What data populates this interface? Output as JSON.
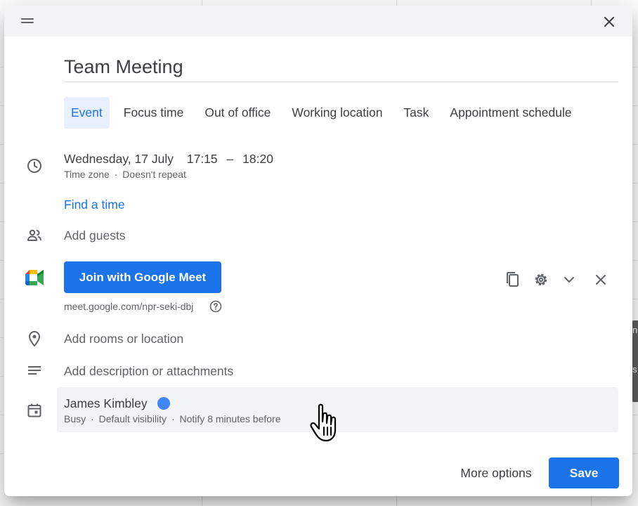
{
  "event": {
    "title": "Team Meeting",
    "date": "Wednesday, 17 July",
    "start_time": "17:15",
    "time_separator": "–",
    "end_time": "18:20",
    "time_zone": "Time zone",
    "repeat": "Doesn't repeat",
    "dot_separator": "·"
  },
  "tabs": [
    {
      "label": "Event",
      "active": true
    },
    {
      "label": "Focus time",
      "active": false
    },
    {
      "label": "Out of office",
      "active": false
    },
    {
      "label": "Working location",
      "active": false
    },
    {
      "label": "Task",
      "active": false
    },
    {
      "label": "Appointment schedule",
      "active": false
    }
  ],
  "find_time_label": "Find a time",
  "guests_placeholder": "Add guests",
  "meet": {
    "join_label": "Join with Google Meet",
    "link": "meet.google.com/npr-seki-dbj"
  },
  "location_placeholder": "Add rooms or location",
  "description_placeholder": "Add description or attachments",
  "calendar": {
    "owner": "James Kimbley",
    "color": "#4285f4",
    "status": "Busy",
    "visibility": "Default visibility",
    "notification": "Notify 8 minutes before"
  },
  "footer": {
    "more_options_label": "More options",
    "save_label": "Save"
  },
  "background_event_fragments": [
    "n",
    "s"
  ],
  "colors": {
    "accent": "#1a73e8",
    "tab_active_bg": "#e8f0fe",
    "header_bg": "#f1f3f4"
  },
  "icons": {
    "drag": "drag-handle-icon",
    "close": "close-icon",
    "clock": "clock-icon",
    "guests": "people-icon",
    "meet": "google-meet-icon",
    "copy": "copy-icon",
    "settings": "gear-icon",
    "expand": "chevron-down-icon",
    "help": "help-icon",
    "location": "location-pin-icon",
    "description": "notes-icon",
    "calendar": "calendar-icon",
    "cursor": "hand-pointer-icon"
  }
}
